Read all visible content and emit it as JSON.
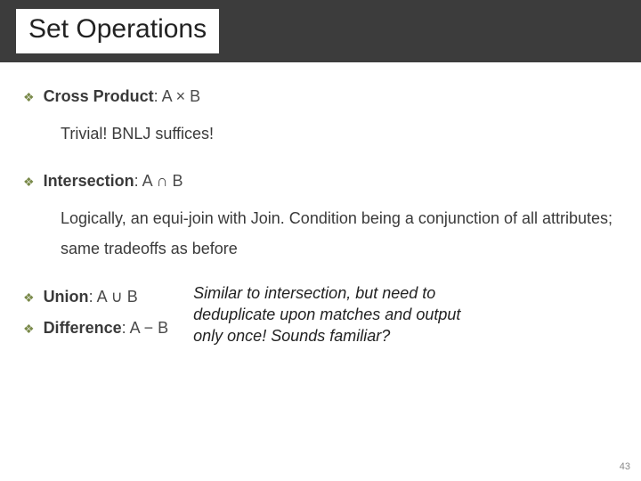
{
  "slide": {
    "title": "Set Operations",
    "page_number": "43",
    "bullets": {
      "cross": {
        "label": "Cross Product",
        "expr": ": A × B",
        "sub": "Trivial! BNLJ suffices!"
      },
      "intersect": {
        "label": "Intersection",
        "expr": ": A ∩ B",
        "sub": "Logically, an equi-join with Join. Condition being a conjunction of all attributes;  same tradeoffs as before"
      },
      "union": {
        "label": "Union",
        "expr": ": A ∪ B"
      },
      "diff": {
        "label": "Difference",
        "expr": ": A − B"
      }
    },
    "annotation": "Similar to intersection, but need to deduplicate upon matches and output only once! Sounds familiar?",
    "icons": {
      "bullet": "❖"
    }
  }
}
